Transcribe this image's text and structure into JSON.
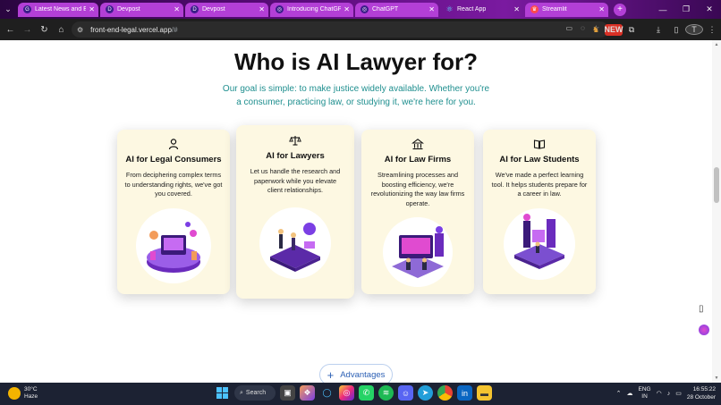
{
  "browser": {
    "tabs": [
      {
        "label": "Latest News and Eve",
        "fav": "G"
      },
      {
        "label": "Devpost",
        "fav": "D"
      },
      {
        "label": "Devpost",
        "fav": "D"
      },
      {
        "label": "Introducing ChatGP",
        "fav": "◎"
      },
      {
        "label": "ChatGPT",
        "fav": "◎"
      },
      {
        "label": "React App",
        "fav": "⚛"
      },
      {
        "label": "Streamlit",
        "fav": "♛"
      }
    ],
    "url_main": "front-end-legal.vercel.app",
    "url_suffix": "/#",
    "ext_badge": "NEW",
    "profile_initial": "T"
  },
  "page": {
    "headline": "Who is AI Lawyer for?",
    "subline": "Our goal is simple: to make justice widely available. Whether you're a consumer, practicing law, or studying it, we're here for you.",
    "cards": [
      {
        "icon": "person-icon",
        "title": "AI for Legal Consumers",
        "desc": "From deciphering complex terms to understanding rights, we've got you covered."
      },
      {
        "icon": "scales-icon",
        "title": "AI for Lawyers",
        "desc": "Let us handle the research and paperwork while you elevate client relationships."
      },
      {
        "icon": "bank-icon",
        "title": "AI for Law Firms",
        "desc": "Streamlining processes and boosting efficiency, we're revolutionizing the way law firms operate."
      },
      {
        "icon": "book-icon",
        "title": "AI for Law Students",
        "desc": "We've made a perfect learning tool. It helps students prepare for a career in law."
      }
    ],
    "advantages_label": "Advantages"
  },
  "taskbar": {
    "temp": "30°C",
    "weather": "Haze",
    "search": "Search",
    "lang1": "ENG",
    "lang2": "IN",
    "time": "16:55:22",
    "date": "28 October"
  },
  "colors": {
    "accent_teal": "#1f8f8f",
    "card_bg": "#fdf8e2",
    "tab_pink": "#b33fd6"
  }
}
